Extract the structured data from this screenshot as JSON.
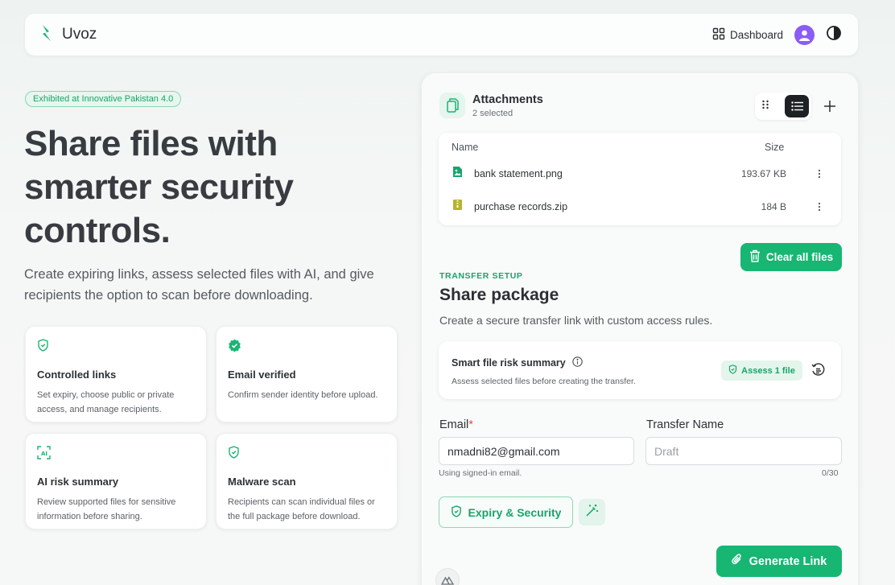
{
  "brand": {
    "name": "Uvoz",
    "accent": "#17b673"
  },
  "nav": {
    "dashboard_label": "Dashboard"
  },
  "hero": {
    "badge": "Exhibited at Innovative Pakistan 4.0",
    "title": "Share files with smarter security controls.",
    "subtitle": "Create expiring links, assess selected files with AI, and give recipients the option to scan before downloading."
  },
  "features": [
    {
      "icon": "shield-icon",
      "title": "Controlled links",
      "desc": "Set expiry, choose public or private access, and manage recipients."
    },
    {
      "icon": "verified-badge-icon",
      "title": "Email verified",
      "desc": "Confirm sender identity before upload."
    },
    {
      "icon": "ai-scan-icon",
      "title": "AI risk summary",
      "desc": "Review supported files for sensitive information before sharing."
    },
    {
      "icon": "shield-icon",
      "title": "Malware scan",
      "desc": "Recipients can scan individual files or the full package before download."
    }
  ],
  "attachments": {
    "title": "Attachments",
    "count": "2 selected",
    "columns": {
      "name": "Name",
      "size": "Size"
    },
    "files": [
      {
        "name": "bank statement.png",
        "size": "193.67 KB",
        "icon": "image-file-icon"
      },
      {
        "name": "purchase records.zip",
        "size": "184 B",
        "icon": "zip-file-icon"
      }
    ],
    "clear_label": "Clear all files"
  },
  "transfer": {
    "eyebrow": "TRANSFER SETUP",
    "title": "Share package",
    "subtitle": "Create a secure transfer link with custom access rules.",
    "risk": {
      "title": "Smart file risk summary",
      "desc": "Assess selected files before creating the transfer.",
      "assess_label": "Assess 1 file"
    },
    "email": {
      "label": "Email",
      "required_mark": "*",
      "value": "nmadni82@gmail.com",
      "hint": "Using signed-in email."
    },
    "name": {
      "label": "Transfer Name",
      "placeholder": "Draft",
      "counter": "0/30"
    },
    "expiry_label": "Expiry & Security",
    "generate_label": "Generate Link"
  }
}
